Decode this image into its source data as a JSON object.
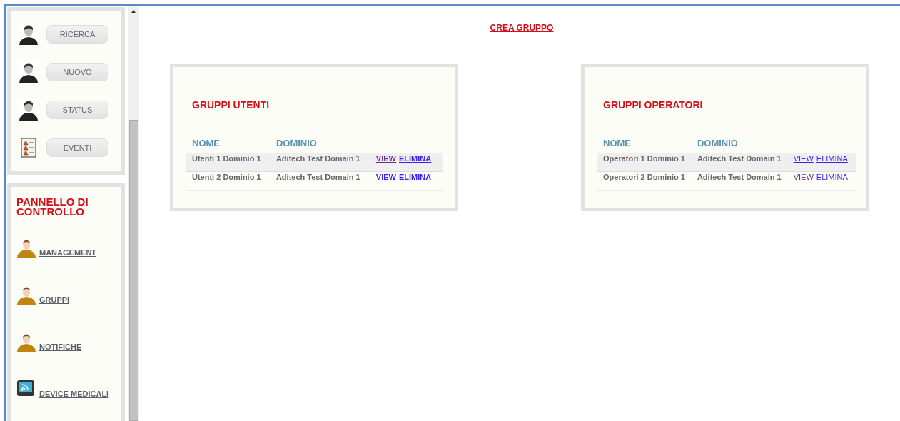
{
  "sidebar": {
    "actions": [
      {
        "label": "RICERCA",
        "kind": "user"
      },
      {
        "label": "NUOVO",
        "kind": "user"
      },
      {
        "label": "STATUS",
        "kind": "user"
      },
      {
        "label": "EVENTI",
        "kind": "list"
      }
    ],
    "control_panel": {
      "title": "PANNELLO DI CONTROLLO",
      "items": [
        {
          "label": "MANAGEMENT",
          "kind": "person"
        },
        {
          "label": "GRUPPI",
          "kind": "person"
        },
        {
          "label": "NOTIFICHE",
          "kind": "person"
        },
        {
          "label": "DEVICE MEDICALI",
          "kind": "device"
        }
      ]
    }
  },
  "create_link": "CREA GRUPPO",
  "panels": [
    {
      "title": "GRUPPI UTENTI",
      "links_bold": true,
      "columns": [
        "NOME",
        "DOMINIO"
      ],
      "rows": [
        {
          "name": "Utenti 1 Dominio 1",
          "domain": "Aditech Test Domain 1",
          "highlighted": true,
          "links": [
            {
              "label": "VIEW",
              "visited": true
            },
            {
              "label": "ELIMINA",
              "visited": false
            }
          ]
        },
        {
          "name": "Utenti 2 Dominio 1",
          "domain": "Aditech Test Domain 1",
          "highlighted": false,
          "links": [
            {
              "label": "VIEW",
              "visited": false
            },
            {
              "label": "ELIMINA",
              "visited": false
            }
          ]
        }
      ]
    },
    {
      "title": "GRUPPI OPERATORI",
      "links_bold": false,
      "columns": [
        "NOME",
        "DOMINIO"
      ],
      "rows": [
        {
          "name": "Operatori 1 Dominio 1",
          "domain": "Aditech Test Domain 1",
          "highlighted": true,
          "links": [
            {
              "label": "VIEW",
              "visited": false
            },
            {
              "label": "ELIMINA",
              "visited": false
            }
          ]
        },
        {
          "name": "Operatori 2 Dominio 1",
          "domain": "Aditech Test Domain 1",
          "highlighted": false,
          "links": [
            {
              "label": "VIEW",
              "visited": true
            },
            {
              "label": "ELIMINA",
              "visited": false
            }
          ]
        }
      ]
    }
  ]
}
